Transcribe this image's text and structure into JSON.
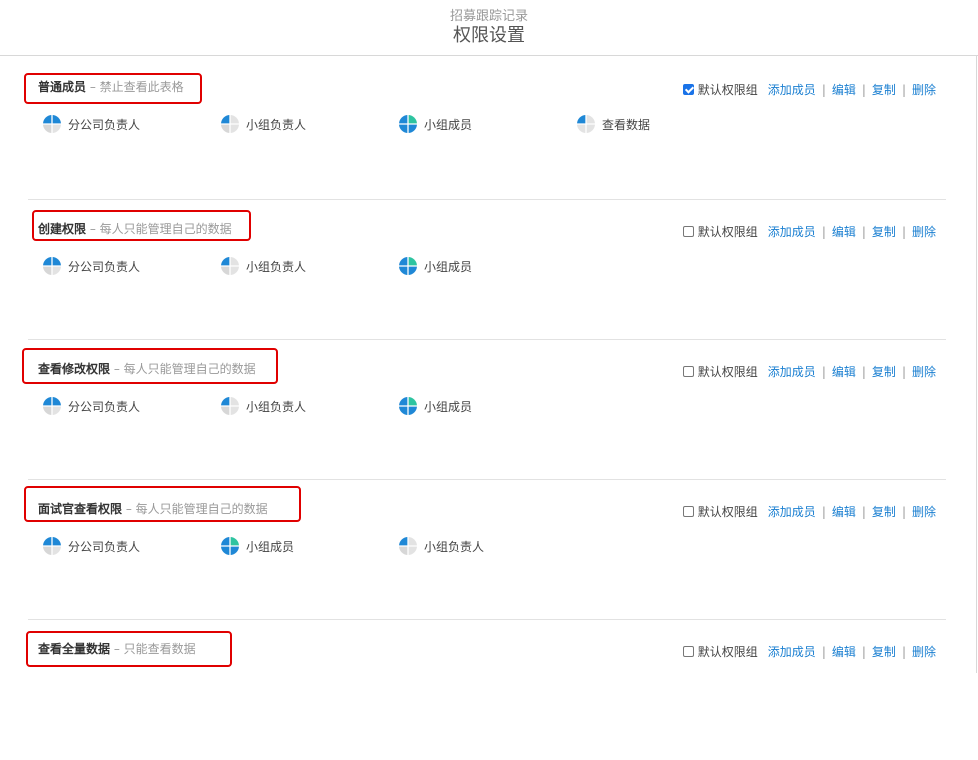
{
  "header": {
    "subtitle": "招募跟踪记录",
    "title": "权限设置"
  },
  "colors": {
    "link": "#1a7fd1",
    "highlight_box": "#e00000",
    "pie_blue": "#1f88d6",
    "pie_green": "#2ec4a0",
    "pie_gray": "#e3e3e3"
  },
  "actions": {
    "default_group": "默认权限组",
    "add_member": "添加成员",
    "edit": "编辑",
    "copy": "复制",
    "delete": "删除",
    "separator": "|"
  },
  "groups": [
    {
      "name": "普通成员",
      "desc": " – 禁止查看此表格",
      "default_checked": true,
      "members": [
        {
          "label": "分公司负责人",
          "icon": "role-pie-icon"
        },
        {
          "label": "小组负责人",
          "icon": "role-pie-icon"
        },
        {
          "label": "小组成员",
          "icon": "role-pie-icon"
        },
        {
          "label": "查看数据",
          "icon": "role-pie-icon"
        }
      ]
    },
    {
      "name": "创建权限",
      "desc": " – 每人只能管理自己的数据",
      "default_checked": false,
      "members": [
        {
          "label": "分公司负责人",
          "icon": "role-pie-icon"
        },
        {
          "label": "小组负责人",
          "icon": "role-pie-icon"
        },
        {
          "label": "小组成员",
          "icon": "role-pie-icon"
        }
      ]
    },
    {
      "name": "查看修改权限",
      "desc": " – 每人只能管理自己的数据",
      "default_checked": false,
      "members": [
        {
          "label": "分公司负责人",
          "icon": "role-pie-icon"
        },
        {
          "label": "小组负责人",
          "icon": "role-pie-icon"
        },
        {
          "label": "小组成员",
          "icon": "role-pie-icon"
        }
      ]
    },
    {
      "name": "面试官查看权限",
      "desc": " – 每人只能管理自己的数据",
      "default_checked": false,
      "members": [
        {
          "label": "分公司负责人",
          "icon": "role-pie-icon"
        },
        {
          "label": "小组成员",
          "icon": "role-pie-icon"
        },
        {
          "label": "小组负责人",
          "icon": "role-pie-icon"
        }
      ]
    },
    {
      "name": "查看全量数据",
      "desc": " – 只能查看数据",
      "default_checked": false,
      "members": []
    }
  ]
}
